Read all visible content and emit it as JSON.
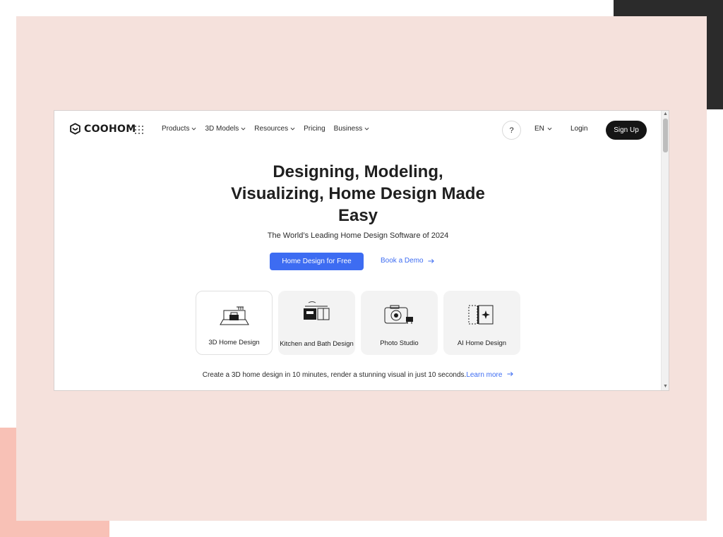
{
  "brand": {
    "name": "COOHOM"
  },
  "nav": {
    "menu": [
      {
        "label": "Products",
        "dropdown": true
      },
      {
        "label": "3D Models",
        "dropdown": true
      },
      {
        "label": "Resources",
        "dropdown": true
      },
      {
        "label": "Pricing",
        "dropdown": false
      },
      {
        "label": "Business",
        "dropdown": true
      }
    ],
    "help": "?",
    "language": "EN",
    "login": "Login",
    "signup": "Sign Up"
  },
  "hero": {
    "title_lines": [
      "Designing, Modeling,",
      "Visualizing, Home Design Made",
      "Easy"
    ],
    "subtitle": "The World’s Leading Home Design Software of 2024",
    "primary_cta": "Home Design for Free",
    "secondary_cta": "Book a Demo"
  },
  "cards": [
    {
      "label": "3D Home Design",
      "icon": "room-3d-icon",
      "selected": true
    },
    {
      "label": "Kitchen and Bath Design",
      "icon": "kitchen-icon",
      "selected": false
    },
    {
      "label": "Photo Studio",
      "icon": "camera-icon",
      "selected": false
    },
    {
      "label": "AI Home Design",
      "icon": "ai-sparkle-icon",
      "selected": false
    }
  ],
  "footer_note": {
    "text": "Create a 3D home design in 10 minutes, render a stunning visual in just 10 seconds.",
    "link": "Learn more"
  },
  "colors": {
    "accent": "#3d6cf2",
    "dark": "#151515",
    "panel_bg": "#f5e1dc"
  }
}
